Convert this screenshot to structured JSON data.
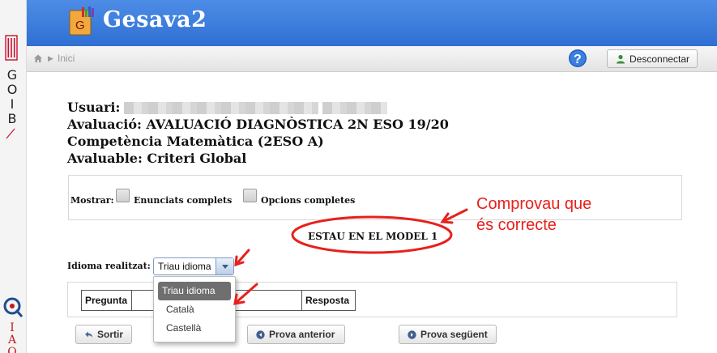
{
  "sidebar": {
    "goib_letters": [
      "G",
      "O",
      "I",
      "B"
    ],
    "iaq_letters": [
      "I",
      "A",
      "Q"
    ]
  },
  "header": {
    "app_icon_letter": "G",
    "title": "Gesava2"
  },
  "navbar": {
    "breadcrumb_home": "Inici",
    "disconnect_label": "Desconnectar"
  },
  "info": {
    "usuari_label": "Usuari:",
    "avaluacio": "Avaluació: AVALUACIÓ DIAGNÒSTICA 2N ESO 19/20",
    "competencia": "Competència Matemàtica (2ESO A)",
    "avaluable": "Avaluable: Criteri Global"
  },
  "options": {
    "mostrar_label": "Mostrar:",
    "enunciats_label": "Enunciats complets",
    "opcions_label": "Opcions completes"
  },
  "model_text": "ESTAU EN EL MODEL 1",
  "annotation": {
    "line1": "Comprovau que",
    "line2": "és correcte"
  },
  "idioma": {
    "label": "Idioma realitzat:",
    "selected": "Triau idioma",
    "options": [
      "Triau idioma",
      "Català",
      "Castellà"
    ]
  },
  "table": {
    "col_pregunta": "Pregunta",
    "col_resposta": "Resposta"
  },
  "buttons": {
    "sortir": "Sortir",
    "prova_anterior": "Prova anterior",
    "prova_seguent": "Prova següent"
  },
  "colors": {
    "header_blue": "#2f6fd4",
    "annotation_red": "#e8201c"
  }
}
